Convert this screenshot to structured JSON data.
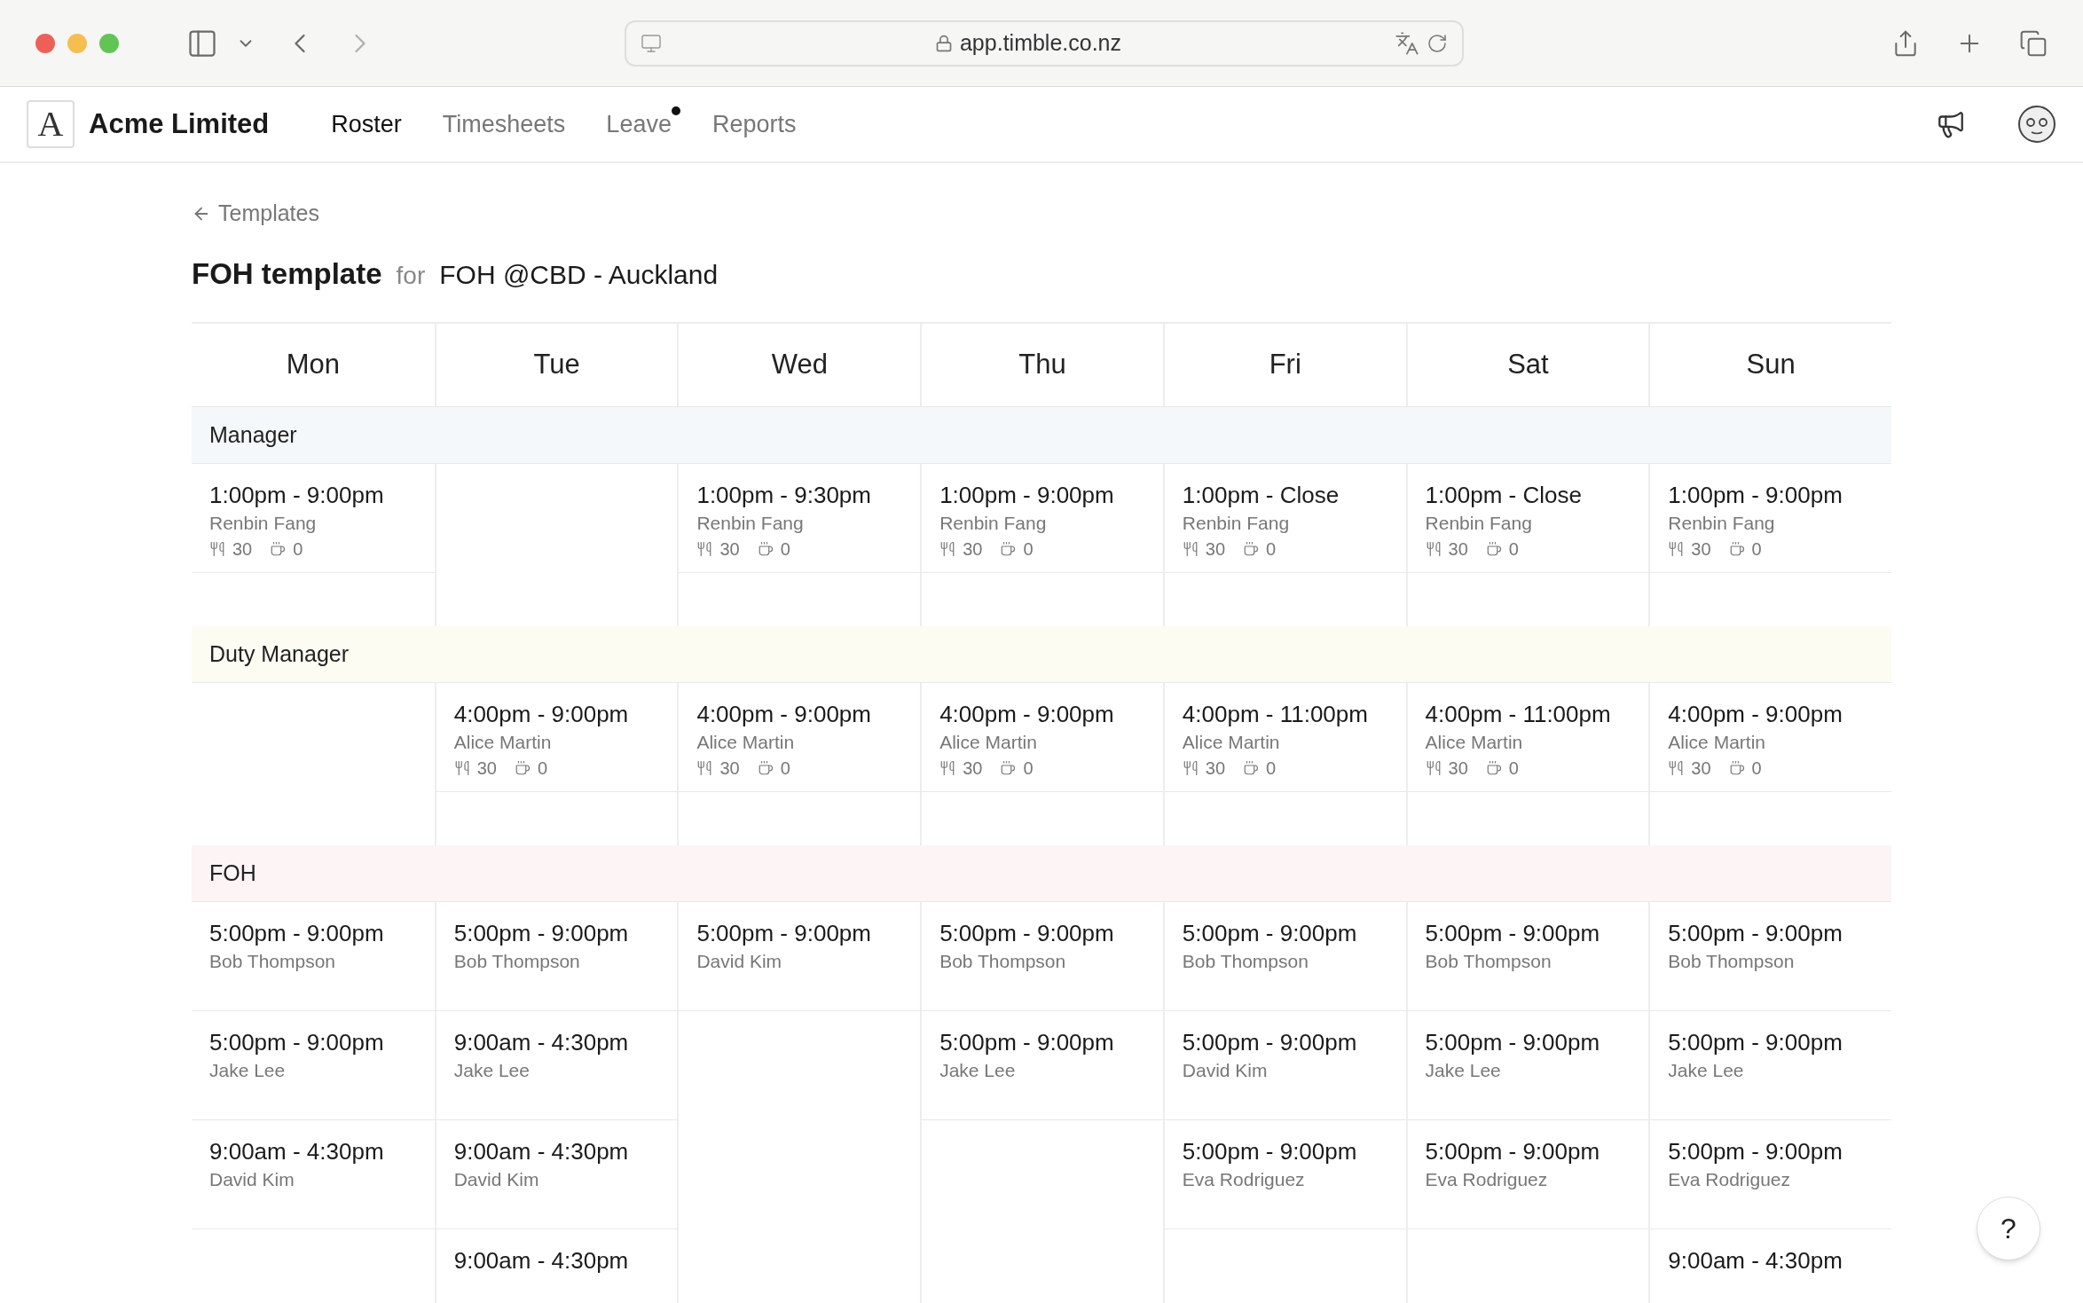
{
  "browser": {
    "url": "app.timble.co.nz"
  },
  "nav": {
    "logo_letter": "A",
    "company": "Acme Limited",
    "items": [
      {
        "label": "Roster",
        "selected": true,
        "dot": false
      },
      {
        "label": "Timesheets",
        "selected": false,
        "dot": false
      },
      {
        "label": "Leave",
        "selected": false,
        "dot": true
      },
      {
        "label": "Reports",
        "selected": false,
        "dot": false
      }
    ]
  },
  "back_link": "Templates",
  "heading": {
    "title": "FOH template",
    "joiner": "for",
    "location": "FOH @CBD - Auckland"
  },
  "days": [
    "Mon",
    "Tue",
    "Wed",
    "Thu",
    "Fri",
    "Sat",
    "Sun"
  ],
  "sections": [
    {
      "name": "Manager",
      "color": "#f4f8fa",
      "columns": [
        {
          "shifts": [
            {
              "time": "1:00pm - 9:00pm",
              "name": "Renbin Fang",
              "meal": "30",
              "rest": "0"
            }
          ]
        },
        {},
        {
          "shifts": [
            {
              "time": "1:00pm - 9:30pm",
              "name": "Renbin Fang",
              "meal": "30",
              "rest": "0"
            }
          ]
        },
        {
          "shifts": [
            {
              "time": "1:00pm - 9:00pm",
              "name": "Renbin Fang",
              "meal": "30",
              "rest": "0"
            }
          ]
        },
        {
          "shifts": [
            {
              "time": "1:00pm - Close",
              "name": "Renbin Fang",
              "meal": "30",
              "rest": "0"
            }
          ]
        },
        {
          "shifts": [
            {
              "time": "1:00pm - Close",
              "name": "Renbin Fang",
              "meal": "30",
              "rest": "0"
            }
          ]
        },
        {
          "shifts": [
            {
              "time": "1:00pm - 9:00pm",
              "name": "Renbin Fang",
              "meal": "30",
              "rest": "0"
            }
          ]
        }
      ]
    },
    {
      "name": "Duty Manager",
      "color": "#fdfcf3",
      "columns": [
        {},
        {
          "shifts": [
            {
              "time": "4:00pm - 9:00pm",
              "name": "Alice Martin",
              "meal": "30",
              "rest": "0"
            }
          ]
        },
        {
          "shifts": [
            {
              "time": "4:00pm - 9:00pm",
              "name": "Alice Martin",
              "meal": "30",
              "rest": "0"
            }
          ]
        },
        {
          "shifts": [
            {
              "time": "4:00pm - 9:00pm",
              "name": "Alice Martin",
              "meal": "30",
              "rest": "0"
            }
          ]
        },
        {
          "shifts": [
            {
              "time": "4:00pm - 11:00pm",
              "name": "Alice Martin",
              "meal": "30",
              "rest": "0"
            }
          ]
        },
        {
          "shifts": [
            {
              "time": "4:00pm - 11:00pm",
              "name": "Alice Martin",
              "meal": "30",
              "rest": "0"
            }
          ]
        },
        {
          "shifts": [
            {
              "time": "4:00pm - 9:00pm",
              "name": "Alice Martin",
              "meal": "30",
              "rest": "0"
            }
          ]
        }
      ]
    },
    {
      "name": "FOH",
      "color": "#fdf4f6",
      "columns": [
        {
          "shifts": [
            {
              "time": "5:00pm - 9:00pm",
              "name": "Bob Thompson"
            },
            {
              "time": "5:00pm - 9:00pm",
              "name": "Jake Lee"
            },
            {
              "time": "9:00am - 4:30pm",
              "name": "David Kim"
            }
          ]
        },
        {
          "shifts": [
            {
              "time": "5:00pm - 9:00pm",
              "name": "Bob Thompson"
            },
            {
              "time": "9:00am - 4:30pm",
              "name": "Jake Lee"
            },
            {
              "time": "9:00am - 4:30pm",
              "name": "David Kim"
            },
            {
              "time": "9:00am - 4:30pm"
            }
          ]
        },
        {
          "shifts": [
            {
              "time": "5:00pm - 9:00pm",
              "name": "David Kim"
            }
          ]
        },
        {
          "shifts": [
            {
              "time": "5:00pm - 9:00pm",
              "name": "Bob Thompson"
            },
            {
              "time": "5:00pm - 9:00pm",
              "name": "Jake Lee"
            }
          ]
        },
        {
          "shifts": [
            {
              "time": "5:00pm - 9:00pm",
              "name": "Bob Thompson"
            },
            {
              "time": "5:00pm - 9:00pm",
              "name": "David Kim"
            },
            {
              "time": "5:00pm - 9:00pm",
              "name": "Eva Rodriguez"
            }
          ]
        },
        {
          "shifts": [
            {
              "time": "5:00pm - 9:00pm",
              "name": "Bob Thompson"
            },
            {
              "time": "5:00pm - 9:00pm",
              "name": "Jake Lee"
            },
            {
              "time": "5:00pm - 9:00pm",
              "name": "Eva Rodriguez"
            }
          ]
        },
        {
          "shifts": [
            {
              "time": "5:00pm - 9:00pm",
              "name": "Bob Thompson"
            },
            {
              "time": "5:00pm - 9:00pm",
              "name": "Jake Lee"
            },
            {
              "time": "5:00pm - 9:00pm",
              "name": "Eva Rodriguez"
            },
            {
              "time": "9:00am - 4:30pm"
            }
          ]
        }
      ]
    }
  ],
  "help": "?"
}
